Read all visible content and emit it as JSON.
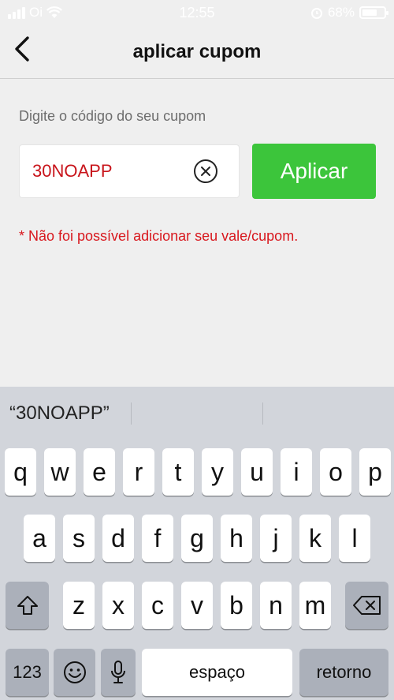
{
  "status_bar": {
    "carrier": "Oi",
    "time": "12:55",
    "battery": "68%",
    "battery_level": 0.68
  },
  "nav": {
    "title": "aplicar cupom"
  },
  "coupon": {
    "prompt": "Digite o código do seu cupom",
    "code": "30NOAPP",
    "apply_label": "Aplicar",
    "error": "* Não foi possível adicionar seu vale/cupom."
  },
  "keyboard": {
    "suggestion": "“30NOAPP”",
    "row1": [
      "q",
      "w",
      "e",
      "r",
      "t",
      "y",
      "u",
      "i",
      "o",
      "p"
    ],
    "row2": [
      "a",
      "s",
      "d",
      "f",
      "g",
      "h",
      "j",
      "k",
      "l"
    ],
    "row3": [
      "z",
      "x",
      "c",
      "v",
      "b",
      "n",
      "m"
    ],
    "numbers_label": "123",
    "space_label": "espaço",
    "return_label": "retorno"
  },
  "colors": {
    "accent_green": "#3cc53b",
    "error_red": "#d8171d"
  }
}
